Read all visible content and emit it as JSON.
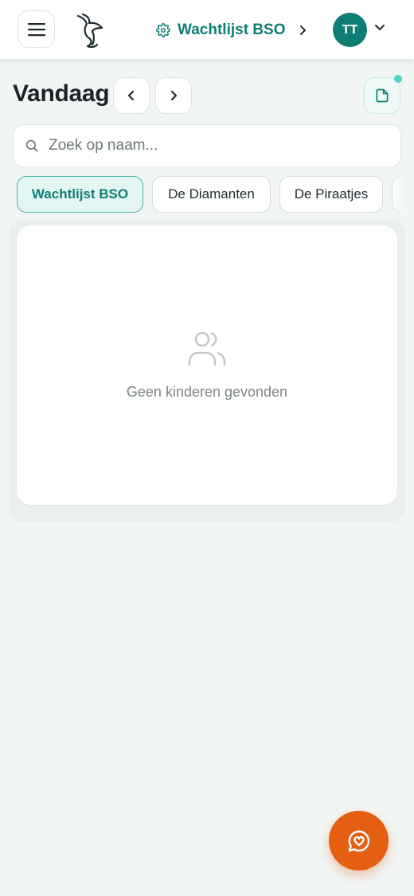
{
  "header": {
    "location_name": "Wachtlijst BSO",
    "user_initials": "TT"
  },
  "page": {
    "title": "Vandaag"
  },
  "search": {
    "placeholder": "Zoek op naam...",
    "value": ""
  },
  "tabs": [
    {
      "label": "Wachtlijst BSO",
      "active": true
    },
    {
      "label": "De Diamanten",
      "active": false
    },
    {
      "label": "De Piraatjes",
      "active": false
    }
  ],
  "empty_state": {
    "icon": "users-icon",
    "message": "Geen kinderen gevonden"
  },
  "colors": {
    "brand": "#0f7d74",
    "accent": "#e45f12",
    "background": "#f1f6f5"
  }
}
